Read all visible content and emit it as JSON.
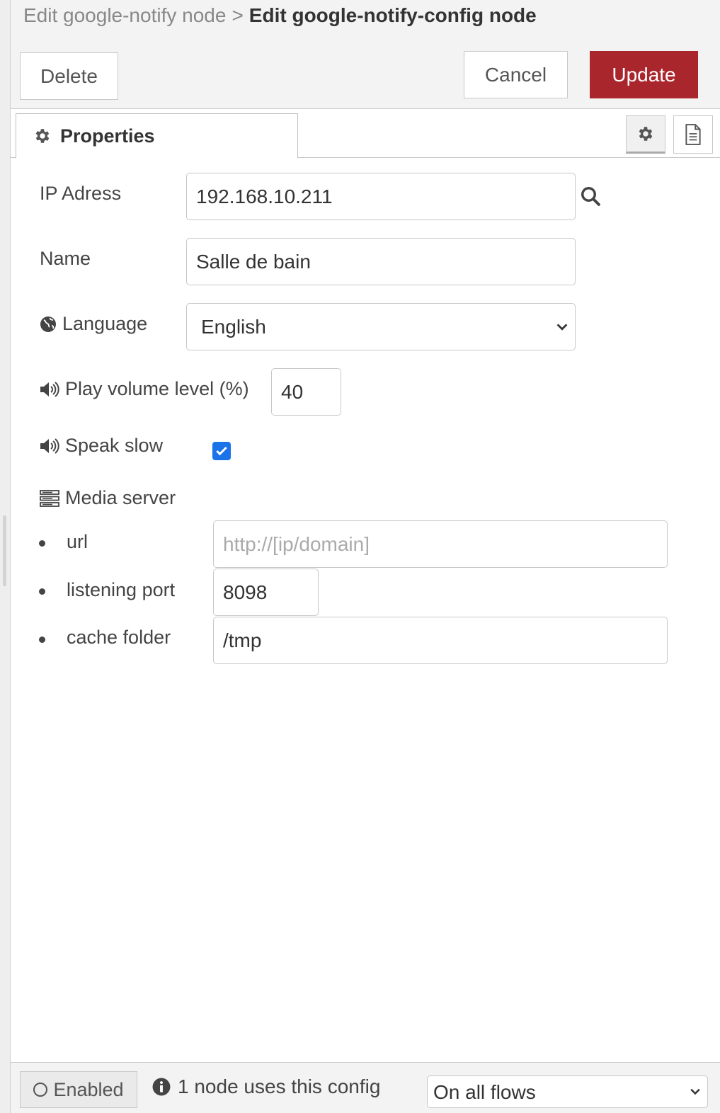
{
  "breadcrumb": {
    "parent": "Edit google-notify node",
    "separator": ">",
    "current": "Edit google-notify-config node"
  },
  "toolbar": {
    "delete_label": "Delete",
    "cancel_label": "Cancel",
    "update_label": "Update",
    "update_color": "#a9262c"
  },
  "tabs": {
    "properties_label": "Properties",
    "icons": [
      "gear-icon",
      "document-icon"
    ]
  },
  "form": {
    "ip": {
      "label": "IP Adress",
      "value": "192.168.10.211"
    },
    "name": {
      "label": "Name",
      "value": "Salle de bain"
    },
    "language": {
      "label": "Language",
      "selected": "English"
    },
    "volume": {
      "label": "Play volume level (%)",
      "value": "40"
    },
    "speak_slow": {
      "label": "Speak slow",
      "checked": true
    },
    "media_server": {
      "label": "Media server",
      "url": {
        "label": "url",
        "value": "",
        "placeholder": "http://[ip/domain]"
      },
      "port": {
        "label": "listening port",
        "value": "8098"
      },
      "cache": {
        "label": "cache folder",
        "value": "/tmp"
      }
    }
  },
  "footer": {
    "enabled_label": "Enabled",
    "usage_text": "1 node uses this config",
    "scope_selected": "On all flows"
  }
}
